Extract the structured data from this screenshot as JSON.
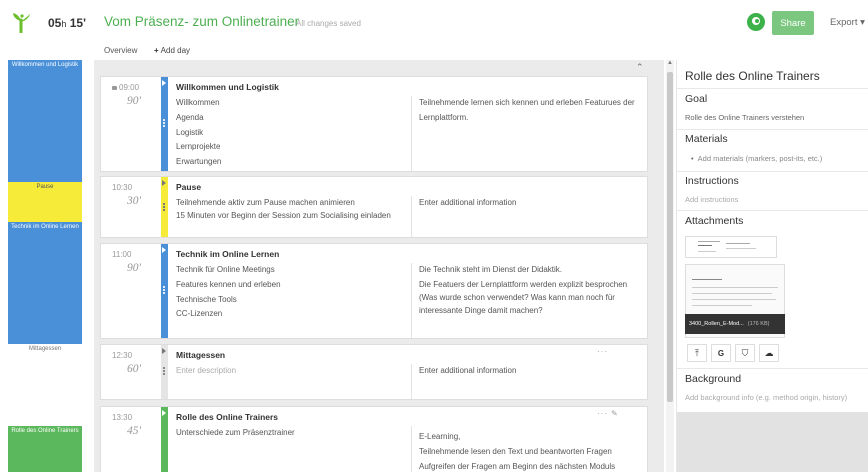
{
  "app": {
    "duration_h": "05",
    "duration_h_unit": "h",
    "duration_m": "15'",
    "title": "Vom Präsenz- zum Onlinetrainer",
    "status": "All changes saved",
    "share_label": "Share",
    "export_label": "Export ▾"
  },
  "nav": {
    "overview": "Overview",
    "add_day_icon": "+",
    "add_day": "Add day"
  },
  "timeline": [
    {
      "label": "Willkommen und Logistik",
      "color": "blue"
    },
    {
      "label": "Pause",
      "color": "yellow"
    },
    {
      "label": "Technik im Online Lernen",
      "color": "blue"
    },
    {
      "label": "Mittagessen",
      "color": "white"
    },
    {
      "label": "Rolle des Online Trainers",
      "color": "green"
    }
  ],
  "blocks": [
    {
      "time": "09:00",
      "duration": "90'",
      "color": "blue",
      "title": "Willkommen und Logistik",
      "content": [
        "Willkommen",
        "Agenda",
        "Logistik",
        "Lernprojekte",
        "Erwartungen"
      ],
      "info": [
        "Teilnehmende lernen sich kennen und erleben Featurues der Lernplattform."
      ]
    },
    {
      "time": "10:30",
      "duration": "30'",
      "color": "yellow",
      "title": "Pause",
      "content": [
        "Teilnehmende aktiv zum Pause machen animieren",
        "15 Minuten vor Beginn der Session zum Socialising einladen"
      ],
      "info_placeholder": "Enter additional information"
    },
    {
      "time": "11:00",
      "duration": "90'",
      "color": "blue",
      "title": "Technik im Online Lernen",
      "content": [
        "Technik für Online Meetings",
        "Features kennen und erleben",
        "Technische Tools",
        "CC-Lizenzen"
      ],
      "info": [
        "Die Technik steht im Dienst der Didaktik.",
        "Die Featuers der Lernplattform werden explizit besprochen (Was wurde schon verwendet? Was kann man noch für interessante Dinge damit machen?"
      ]
    },
    {
      "time": "12:30",
      "duration": "60'",
      "color": "grey",
      "title": "Mittagessen",
      "content_placeholder": "Enter description",
      "info_placeholder": "Enter additional information",
      "more": "···"
    },
    {
      "time": "13:30",
      "duration": "45'",
      "color": "green",
      "title": "Rolle des Online Trainers",
      "content": [
        "Unterschiede zum Präsenztrainer"
      ],
      "info": [
        "E-Learning,",
        "Teilnehmende lesen den Text und beantworten Fragen",
        "Aufgreifen der Fragen am Beginn des nächsten Moduls"
      ],
      "more": "···",
      "clip": "✎"
    }
  ],
  "panel": {
    "title": "Rolle des Online Trainers",
    "goal_heading": "Goal",
    "goal_text": "Rolle des Online Trainers verstehen",
    "materials_heading": "Materials",
    "materials_placeholder": "Add materials (markers, post-its, etc.)",
    "instructions_heading": "Instructions",
    "instructions_placeholder": "Add instructions",
    "attachments_heading": "Attachments",
    "attachment_name": "3400_Rollen_E-Mod...",
    "attachment_pages": "(176 KB)",
    "background_heading": "Background",
    "background_placeholder": "Add background info (e.g. method origin, history)"
  },
  "icons": {
    "upload": "upload-icon",
    "google": "google-drive-icon",
    "dropbox": "dropbox-icon",
    "cloud": "cloud-icon"
  },
  "colors": {
    "brand_green": "#4caf50",
    "blue": "#4a90d9",
    "yellow": "#f7eb3a",
    "green": "#5cb85c"
  }
}
